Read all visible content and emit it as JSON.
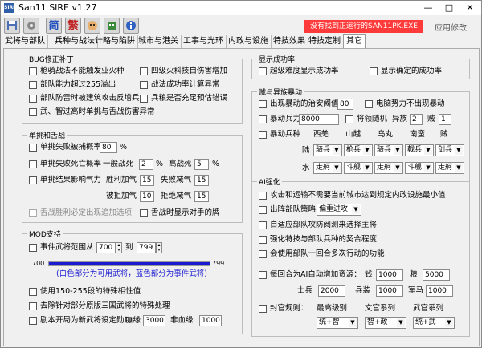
{
  "window": {
    "title": "San11 SIRE v1.27",
    "app_icon": "SIRE",
    "minimize": "—",
    "maximize": "□",
    "close": "✕"
  },
  "toolbar": {
    "simplified": "简",
    "traditional": "繁",
    "error_text": "没有找到正运行的SAN11PK.EXE",
    "apply_label": "应用修改"
  },
  "tabs": [
    "武将与部队",
    "兵种与战法",
    "计略与陷阱",
    "城市与港关",
    "工事与光环",
    "内政与设施",
    "特技效果",
    "特技定制",
    "其它"
  ],
  "bug": {
    "title": "BUG修正补丁",
    "items": [
      "枪骑战法不能触发业火种",
      "四级火科技自伤害增加",
      "部队能力超过255溢出",
      "战法成功率计算异常",
      "部队防雷时被建筑攻击反增兵",
      "兵粮是否充足预估错误",
      "武、智过高时单挑与舌战伤害异常"
    ]
  },
  "duel": {
    "title": "单挑和舌战",
    "capture": "单挑失败被捕概率",
    "capture_val": "80",
    "pct": "%",
    "death": "单挑失败死亡概率",
    "normal": "一般战死",
    "normal_val": "2",
    "high": "高战死",
    "high_val": "5",
    "result": "单挑结果影响气力",
    "win": "胜利加气",
    "win_val": "15",
    "lose": "失败减气",
    "lose_val": "15",
    "refuse_add": "被拒加气",
    "refuse_add_val": "10",
    "refuse_sub": "拒绝减气",
    "refuse_sub_val": "15",
    "no_hist": "舌战胜利必定出现追加选项",
    "opp_hand": "舌战时显示对手的牌"
  },
  "mod": {
    "title": "MOD支持",
    "range": "事件武将范围从",
    "from": "700",
    "to_label": "到",
    "to": "799",
    "left_num": "700",
    "right_num": "799",
    "note": "(白色部分为可用武将，蓝色部分为事件武将)",
    "item1": "使用150-255段的特殊相性值",
    "item2": "去除针对部分原版三国武将的特殊处理",
    "item3": "剧本开局为新武将设定勋功：",
    "blood": "血缘",
    "blood_val": "3000",
    "nonblood": "非血缘",
    "nonblood_val": "1000"
  },
  "display": {
    "title": "显示成功率",
    "super": "超级难度显示成功率",
    "sure": "显示确定的成功率"
  },
  "riot": {
    "title": "贼与异族暴动",
    "threshold": "出现暴动的治安阈值",
    "threshold_val": "80",
    "elec": "电脑势力不出现暴动",
    "force": "暴动兵力",
    "force_val": "8000",
    "lead": "将领随机",
    "tribe": "异族",
    "tribe_val": "2",
    "thief": "贼",
    "thief_val": "1",
    "kinds": "暴动兵种",
    "columns": [
      "西羌",
      "山越",
      "乌丸",
      "南蛮",
      "贼"
    ],
    "land": "陆",
    "land_vals": [
      "骑兵",
      "枪兵",
      "骑兵",
      "戟兵",
      "剑兵"
    ],
    "water": "水",
    "water_vals": [
      "走舸",
      "斗舰",
      "走舸",
      "斗舰",
      "走舸"
    ]
  },
  "ai": {
    "title": "AI强化",
    "items": [
      "攻击和运输不需要当前城市达到规定内政设施最小值",
      "出阵部队策略：",
      "自适应部队攻防阅测来选择主将",
      "强化特技与部队兵种的契合程度",
      "会使用部队一回合多次行动的功能"
    ],
    "strategy": "偏重进攻",
    "monthly": "每回合为AI自动增加资源：",
    "money": "钱",
    "money_val": "1000",
    "food": "粮",
    "food_val": "5000",
    "soldier": "士兵",
    "soldier_val": "2000",
    "weapon": "兵装",
    "weapon_val": "1000",
    "horse": "军马",
    "horse_val": "1000",
    "rank": "封官规则：",
    "col1": "最高级别",
    "col2": "文官系列",
    "col3": "武官系列",
    "v1": "统+智",
    "v2": "智+政",
    "v3": "统+武"
  },
  "colors": {
    "error_bg": "#ff3a3a",
    "bar_blue": "#1a1ad0",
    "note_text": "#1a1ad0"
  },
  "icons": [
    "save-icon",
    "settings-icon",
    "face-icon",
    "mask-icon",
    "info-icon"
  ]
}
